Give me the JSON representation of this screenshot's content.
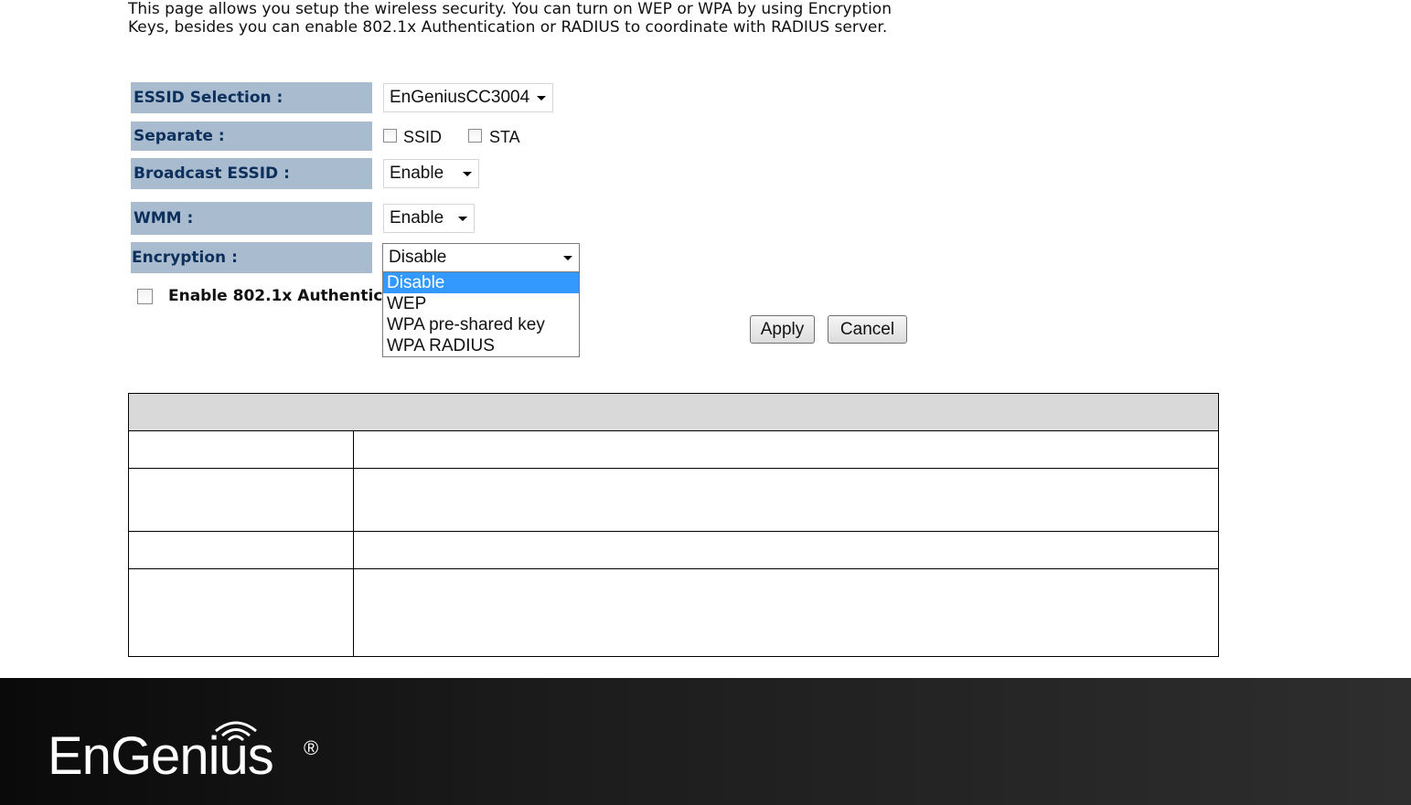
{
  "intro": "This page allows you setup the wireless security. You can turn on WEP or WPA by using Encryption Keys, besides you can enable 802.1x Authentication or RADIUS to coordinate with RADIUS server.",
  "form": {
    "essid_label": "ESSID Selection :",
    "essid_value": "EnGeniusCC3004",
    "separate_label": "Separate :",
    "separate_ssid": "SSID",
    "separate_sta": "STA",
    "broadcast_label": "Broadcast ESSID :",
    "broadcast_value": "Enable",
    "wmm_label": "WMM :",
    "wmm_value": "Enable",
    "encryption_label": "Encryption :",
    "encryption_value": "Disable",
    "encryption_options": [
      "Disable",
      "WEP",
      "WPA pre-shared key",
      "WPA RADIUS"
    ],
    "auth_label": "Enable 802.1x Authentication"
  },
  "buttons": {
    "apply": "Apply",
    "cancel": "Cancel"
  },
  "logo": {
    "text": "EnGenius",
    "reg": "®"
  },
  "colors": {
    "label_bg": "#a9bccf",
    "label_text": "#0d2f5c",
    "selected_option": "#3399ff"
  }
}
